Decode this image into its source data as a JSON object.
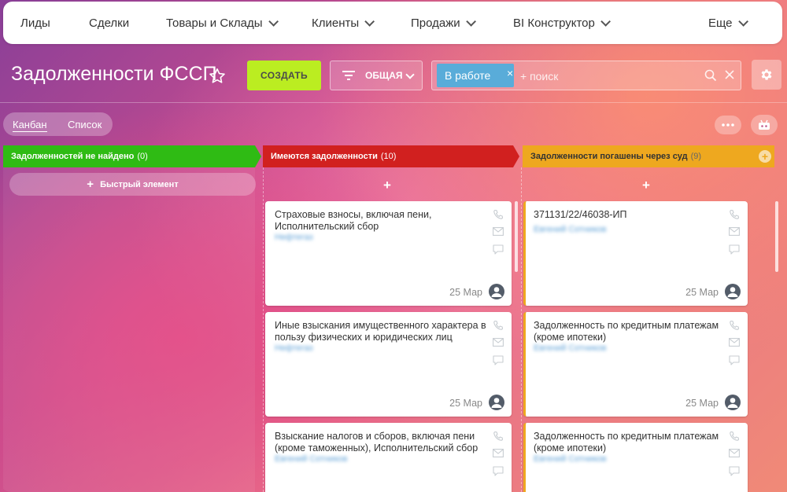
{
  "nav": {
    "items": [
      {
        "label": "Лиды",
        "dropdown": false
      },
      {
        "label": "Сделки",
        "dropdown": false
      },
      {
        "label": "Товары и Склады",
        "dropdown": true
      },
      {
        "label": "Клиенты",
        "dropdown": true
      },
      {
        "label": "Продажи",
        "dropdown": true
      },
      {
        "label": "BI Конструктор",
        "dropdown": true
      },
      {
        "label": "Еще",
        "dropdown": true
      }
    ]
  },
  "toolbar": {
    "title": "Задолженности ФССП",
    "create_label": "СОЗДАТЬ",
    "filter_label": "ОБЩАЯ",
    "filter_tag": "В работе",
    "search_placeholder": "+ поиск"
  },
  "views": {
    "kanban": "Канбан",
    "list": "Список",
    "active": "Канбан"
  },
  "colors": {
    "accent_green": "#bbed21",
    "stage_green": "#2fbb14",
    "stage_red": "#d1201f",
    "stage_yellow": "#eea81f",
    "tag_blue": "#59acd9"
  },
  "columns": [
    {
      "title": "Задолженностей не найдено",
      "count": "(0)",
      "color": "#2fbb14",
      "quick_add_label": "Быстрый элемент",
      "cards": []
    },
    {
      "title": "Имеются задолженности",
      "count": "(10)",
      "color": "#d1201f",
      "cards": [
        {
          "title": "Страховые взносы, включая пени, Исполнительский сбор",
          "subtitle": "Нефтегаз",
          "date": "25 Мар"
        },
        {
          "title": "Иные взыскания имущественного характера в пользу физических и юридических лиц",
          "subtitle": "Нефтегаз",
          "date": "25 Мар"
        },
        {
          "title": "Взыскание налогов и сборов, включая пени (кроме таможенных), Исполнительский сбор",
          "subtitle": "Евгений Сотников",
          "date": ""
        }
      ]
    },
    {
      "title": "Задолженности погашены через суд",
      "count": "(9)",
      "color": "#eea81f",
      "cards": [
        {
          "title": "371131/22/46038-ИП",
          "subtitle": "Евгений Сотников",
          "date": "25 Мар"
        },
        {
          "title": "Задолженность по кредитным платежам (кроме ипотеки)",
          "subtitle": "Евгений Сотников",
          "date": "25 Мар"
        },
        {
          "title": "Задолженность по кредитным платежам (кроме ипотеки)",
          "subtitle": "Евгений Сотников",
          "date": ""
        }
      ]
    }
  ]
}
